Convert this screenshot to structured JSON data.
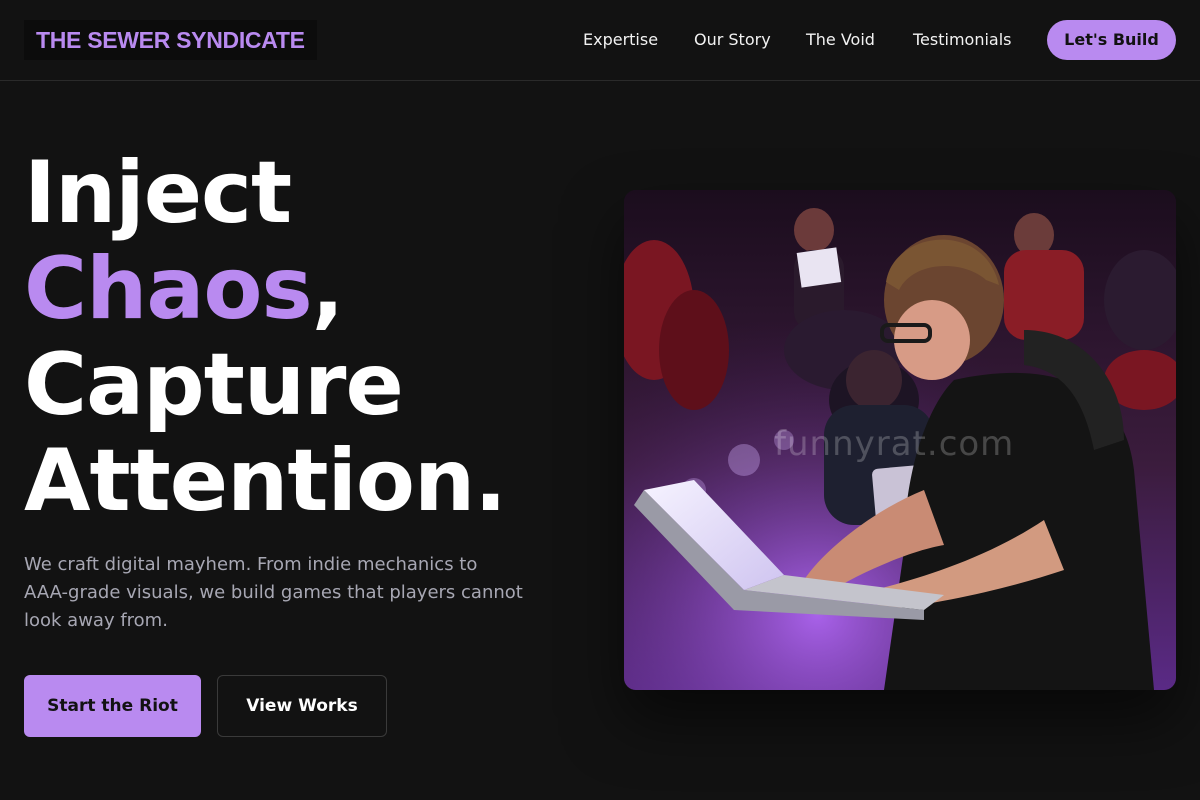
{
  "brand": {
    "logo_text": "THE SEWER SYNDICATE"
  },
  "nav": {
    "links": [
      {
        "label": "Expertise"
      },
      {
        "label": "Our Story"
      },
      {
        "label": "The Void"
      },
      {
        "label": "Testimonials"
      }
    ],
    "cta_label": "Let's Build"
  },
  "hero": {
    "headline": {
      "line1": "Inject",
      "line2_accent": "Chaos",
      "line2_punct": ",",
      "line3": "Capture",
      "line4": "Attention."
    },
    "subtext": "We craft digital mayhem. From indie mechanics to AAA-grade visuals, we build games that players cannot look away from.",
    "primary_button": "Start the Riot",
    "secondary_button": "View Works",
    "image": {
      "watermark": "funnyrat.com"
    }
  },
  "colors": {
    "background": "#121212",
    "accent": "#b98af0",
    "text": "#ffffff",
    "muted_text": "#a7a7b3",
    "border": "#2a2a2a"
  }
}
